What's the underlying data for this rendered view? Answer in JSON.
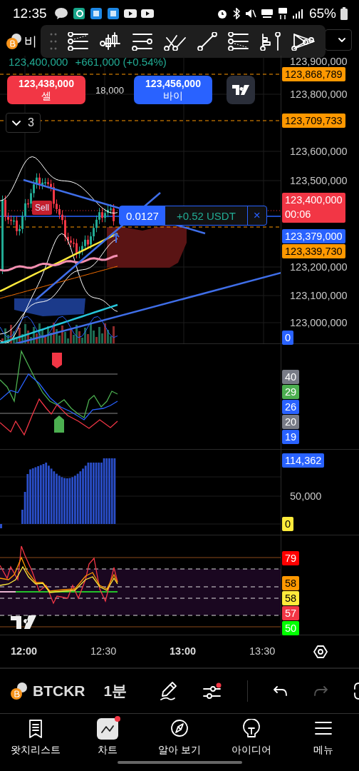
{
  "status_bar": {
    "time": "12:35",
    "battery": "65%"
  },
  "symbol": {
    "name": "비"
  },
  "quote": {
    "last": "123,400,000",
    "change": "+661,000 (+0.54%)"
  },
  "trade": {
    "sell_price": "123,438,000",
    "sell_label": "셀",
    "spread": "18,000",
    "buy_price": "123,456,000",
    "buy_label": "바이"
  },
  "indicators_toggle": {
    "count": "3"
  },
  "signal_marker": {
    "label": "Sell"
  },
  "position": {
    "quantity": "0.0127",
    "pnl": "+0.52 USDT",
    "close": "×"
  },
  "price_axis": [
    {
      "kind": "tick",
      "text": "123,900,000"
    },
    {
      "kind": "badge",
      "text": "123,868,789",
      "color": "#ff9800"
    },
    {
      "kind": "tick",
      "text": "123,800,000"
    },
    {
      "kind": "badge",
      "text": "123,709,733",
      "color": "#ff9800"
    },
    {
      "kind": "tick",
      "text": "123,600,000"
    },
    {
      "kind": "tick",
      "text": "123,500,000"
    },
    {
      "kind": "countdown",
      "text": "123,400,000",
      "sub": "00:06",
      "color": "#f23645"
    },
    {
      "kind": "badge",
      "text": "123,379,000",
      "color": "#2962ff"
    },
    {
      "kind": "badge",
      "text": "123,339,730",
      "color": "#ff9800"
    },
    {
      "kind": "tick",
      "text": "123,200,000"
    },
    {
      "kind": "tick",
      "text": "123,100,000"
    },
    {
      "kind": "tick",
      "text": "123,000,000"
    },
    {
      "kind": "badge",
      "text": "0",
      "color": "#2962ff"
    }
  ],
  "oscillator_axis": [
    {
      "text": "40",
      "color": "#787b86"
    },
    {
      "text": "29",
      "color": "#4caf50"
    },
    {
      "text": "26",
      "color": "#2962ff"
    },
    {
      "text": "20",
      "color": "#787b86"
    },
    {
      "text": "19",
      "color": "#2962ff"
    }
  ],
  "volume_axis": [
    {
      "kind": "badge",
      "text": "114,362",
      "color": "#2962ff"
    },
    {
      "kind": "tick",
      "text": "50,000"
    },
    {
      "kind": "badge",
      "text": "0",
      "color": "#ffeb3b"
    }
  ],
  "rsi_axis": [
    {
      "text": "79",
      "color": "#ff0000"
    },
    {
      "text": "58",
      "color": "#ff9800"
    },
    {
      "text": "58",
      "color": "#ffeb3b"
    },
    {
      "text": "57",
      "color": "#f23645"
    },
    {
      "text": "50",
      "color": "#00ff00"
    }
  ],
  "time_axis": [
    {
      "text": "12:00",
      "bold": true
    },
    {
      "text": "12:30",
      "bold": false
    },
    {
      "text": "13:00",
      "bold": true
    },
    {
      "text": "13:30",
      "bold": false
    }
  ],
  "bottom_toolbar": {
    "symbol": "BTCKR",
    "interval": "1분"
  },
  "nav": [
    {
      "label": "왓치리스트",
      "selected": false
    },
    {
      "label": "차트",
      "selected": true
    },
    {
      "label": "알아 보기",
      "selected": false
    },
    {
      "label": "아이디어",
      "selected": false
    },
    {
      "label": "메뉴",
      "selected": false
    }
  ]
}
